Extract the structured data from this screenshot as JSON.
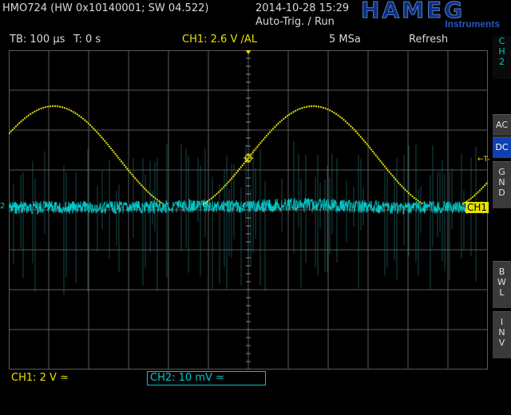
{
  "header": {
    "model": "HMO724 (HW 0x10140001; SW 04.522)",
    "datetime": "2014-10-28 15:29",
    "trigger_mode": "Auto-Trig. / Run",
    "brand": "HAMEG",
    "brand_sub": "Instruments"
  },
  "status": {
    "timebase": "TB: 100 µs",
    "time_offset": "T: 0 s",
    "trigger": "CH1: 2.6 V ∕AL",
    "sample_rate": "5 MSa",
    "acq_mode": "Refresh"
  },
  "right_panel": {
    "channel": [
      "C",
      "H",
      "2"
    ],
    "ac": "AC",
    "dc": "DC",
    "gnd": [
      "G",
      "N",
      "D"
    ],
    "bwl": [
      "B",
      "W",
      "L"
    ],
    "inv": [
      "I",
      "N",
      "V"
    ]
  },
  "bottom": {
    "ch1_scale": "CH1: 2 V ≃",
    "ch2_scale": "CH2: 10 mV ≃"
  },
  "markers": {
    "ch1_tag": "CH1",
    "ch2_marker": "2",
    "trigger_marker": "←T-"
  },
  "colors": {
    "ch1": "#e8e000",
    "ch2": "#00c8c8",
    "grid": "#5a5a5a",
    "active_button": "#1040b0"
  }
}
